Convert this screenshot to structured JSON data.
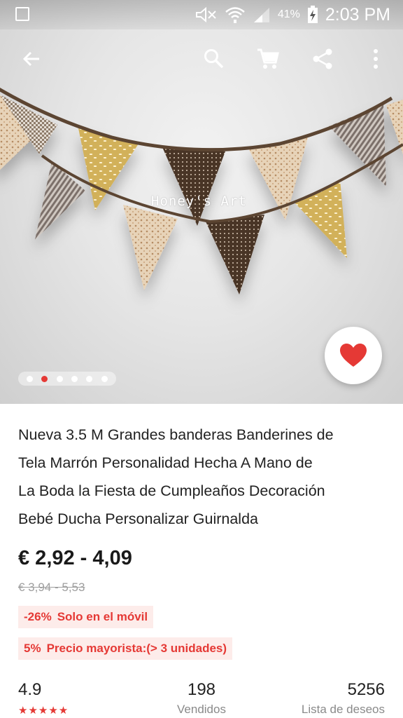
{
  "status_bar": {
    "battery": "41%",
    "time": "2:03 PM",
    "icons": [
      "image-icon",
      "mute-icon",
      "wifi-icon",
      "signal-icon",
      "battery-charging-icon"
    ]
  },
  "toolbar": {
    "icons": [
      "back-arrow-icon",
      "search-icon",
      "cart-icon",
      "share-icon",
      "more-vert-icon"
    ]
  },
  "gallery": {
    "watermark": "Honey's Art",
    "dot_count": 6,
    "active_index": 1
  },
  "colors": {
    "accent": "#e53935",
    "tag_bg": "#fdecea"
  },
  "product": {
    "title_lines": [
      "Nueva 3.5 M Grandes banderas Banderines de",
      "Tela Marrón Personalidad Hecha A Mano de",
      "La Boda la Fiesta de Cumpleaños Decoración",
      "Bebé Ducha Personalizar Guirnalda"
    ],
    "price": "€ 2,92 - 4,09",
    "old_price": "€ 3,94 - 5,53",
    "promo": {
      "discount": "-26%",
      "text": "Solo en el móvil"
    },
    "wholesale": {
      "discount": "5%",
      "text": "Precio mayorista:(> 3 unidades)"
    }
  },
  "stats": {
    "rating": "4.9",
    "stars": "★★★★★",
    "sold": "198",
    "sold_label": "Vendidos",
    "wishlist": "5256",
    "wishlist_label": "Lista de deseos"
  }
}
